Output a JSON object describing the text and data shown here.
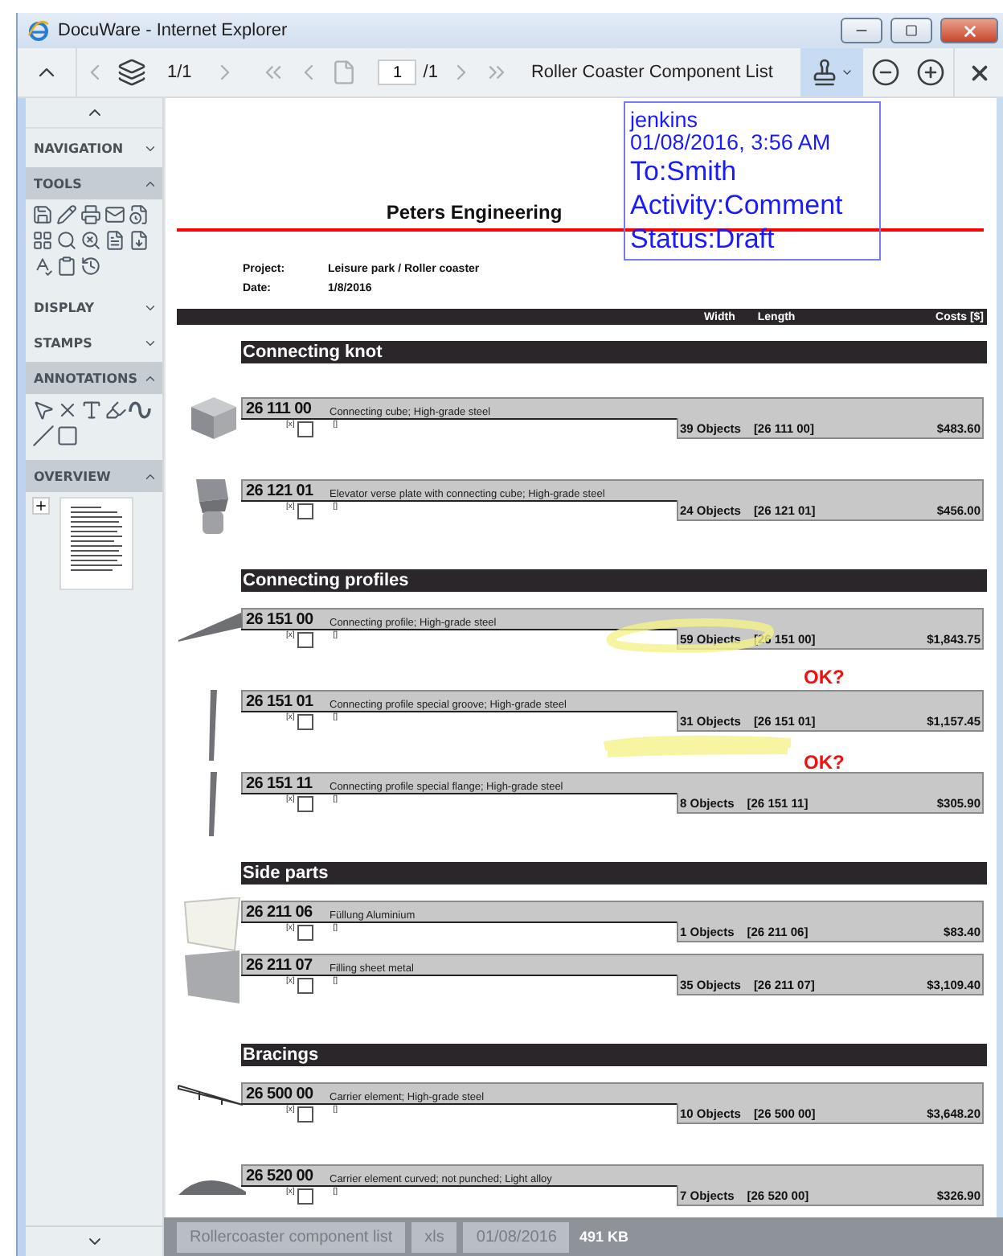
{
  "window": {
    "title": "DocuWare - Internet Explorer"
  },
  "toolbar": {
    "document_pages": "1/1",
    "page_input": "1",
    "page_total": "/1",
    "document_title": "Roller Coaster Component List"
  },
  "sidebar": {
    "sections": [
      {
        "label": "NAVIGATION",
        "expanded": false
      },
      {
        "label": "TOOLS",
        "expanded": true,
        "kind": "tools"
      },
      {
        "label": "DISPLAY",
        "expanded": false
      },
      {
        "label": "STAMPS",
        "expanded": false
      },
      {
        "label": "ANNOTATIONS",
        "expanded": true,
        "kind": "annotations"
      },
      {
        "label": "OVERVIEW",
        "expanded": true,
        "kind": "overview"
      }
    ]
  },
  "document": {
    "company": "Peters Engineering",
    "fields": [
      {
        "label": "Project:",
        "value": "Leisure park / Roller coaster"
      },
      {
        "label": "Date:",
        "value": "1/8/2016"
      }
    ],
    "columns": [
      "Width",
      "Length",
      "Costs [$]"
    ],
    "groups": [
      {
        "title": "Connecting knot",
        "items": [
          {
            "code": "26 111 00",
            "description": "Connecting cube; High-grade steel",
            "mark_1": "[x]",
            "mark_2": "[]",
            "count": "39 Objects",
            "ref": "[26 111 00]",
            "cost": "$483.60"
          },
          {
            "code": "26 121 01",
            "description": "Elevator verse plate with connecting cube; High-grade steel",
            "mark_1": "[x]",
            "mark_2": "[]",
            "count": "24 Objects",
            "ref": "[26 121 01]",
            "cost": "$456.00"
          }
        ]
      },
      {
        "title": "Connecting profiles",
        "items": [
          {
            "code": "26 151 00",
            "description": "Connecting profile; High-grade steel",
            "mark_1": "[x]",
            "mark_2": "[]",
            "count": "59 Objects",
            "ref": "[26 151 00]",
            "cost": "$1,843.75"
          },
          {
            "code": "26 151 01",
            "description": "Connecting profile special groove; High-grade steel",
            "mark_1": "[x]",
            "mark_2": "[]",
            "count": "31 Objects",
            "ref": "[26 151 01]",
            "cost": "$1,157.45"
          },
          {
            "code": "26 151 11",
            "description": "Connecting profile special flange; High-grade steel",
            "mark_1": "[x]",
            "mark_2": "[]",
            "count": "8 Objects",
            "ref": "[26 151 11]",
            "cost": "$305.90"
          }
        ]
      },
      {
        "title": "Side parts",
        "items": [
          {
            "code": "26 211 06",
            "description": "Füllung Aluminium",
            "mark_1": "[x]",
            "mark_2": "[]",
            "count": "1 Objects",
            "ref": "[26 211 06]",
            "cost": "$83.40"
          },
          {
            "code": "26 211 07",
            "description": "Filling sheet metal",
            "mark_1": "[x]",
            "mark_2": "[]",
            "count": "35 Objects",
            "ref": "[26 211 07]",
            "cost": "$3,109.40"
          }
        ]
      },
      {
        "title": "Bracings",
        "items": [
          {
            "code": "26 500 00",
            "description": "Carrier element; High-grade steel",
            "mark_1": "[x]",
            "mark_2": "[]",
            "count": "10 Objects",
            "ref": "[26 500 00]",
            "cost": "$3,648.20"
          },
          {
            "code": "26 520 00",
            "description": "Carrier element curved; not punched; Light alloy",
            "mark_1": "[x]",
            "mark_2": "[]",
            "count": "7 Objects",
            "ref": "[26 520 00]",
            "cost": "$326.90"
          }
        ]
      }
    ]
  },
  "annotations": {
    "stamp": [
      {
        "text": "jenkins",
        "kind": "header"
      },
      {
        "text": "01/08/2016, 3:56 AM",
        "kind": "header"
      },
      {
        "text": "To:Smith",
        "kind": "field"
      },
      {
        "text": "Activity:Comment",
        "kind": "field"
      },
      {
        "text": "Status:Draft",
        "kind": "field"
      }
    ],
    "notes": [
      "OK?",
      "OK?"
    ]
  },
  "status_bar": {
    "tags": [
      "Rollercoaster component list",
      "xls",
      "01/08/2016"
    ],
    "size": "491 KB"
  }
}
